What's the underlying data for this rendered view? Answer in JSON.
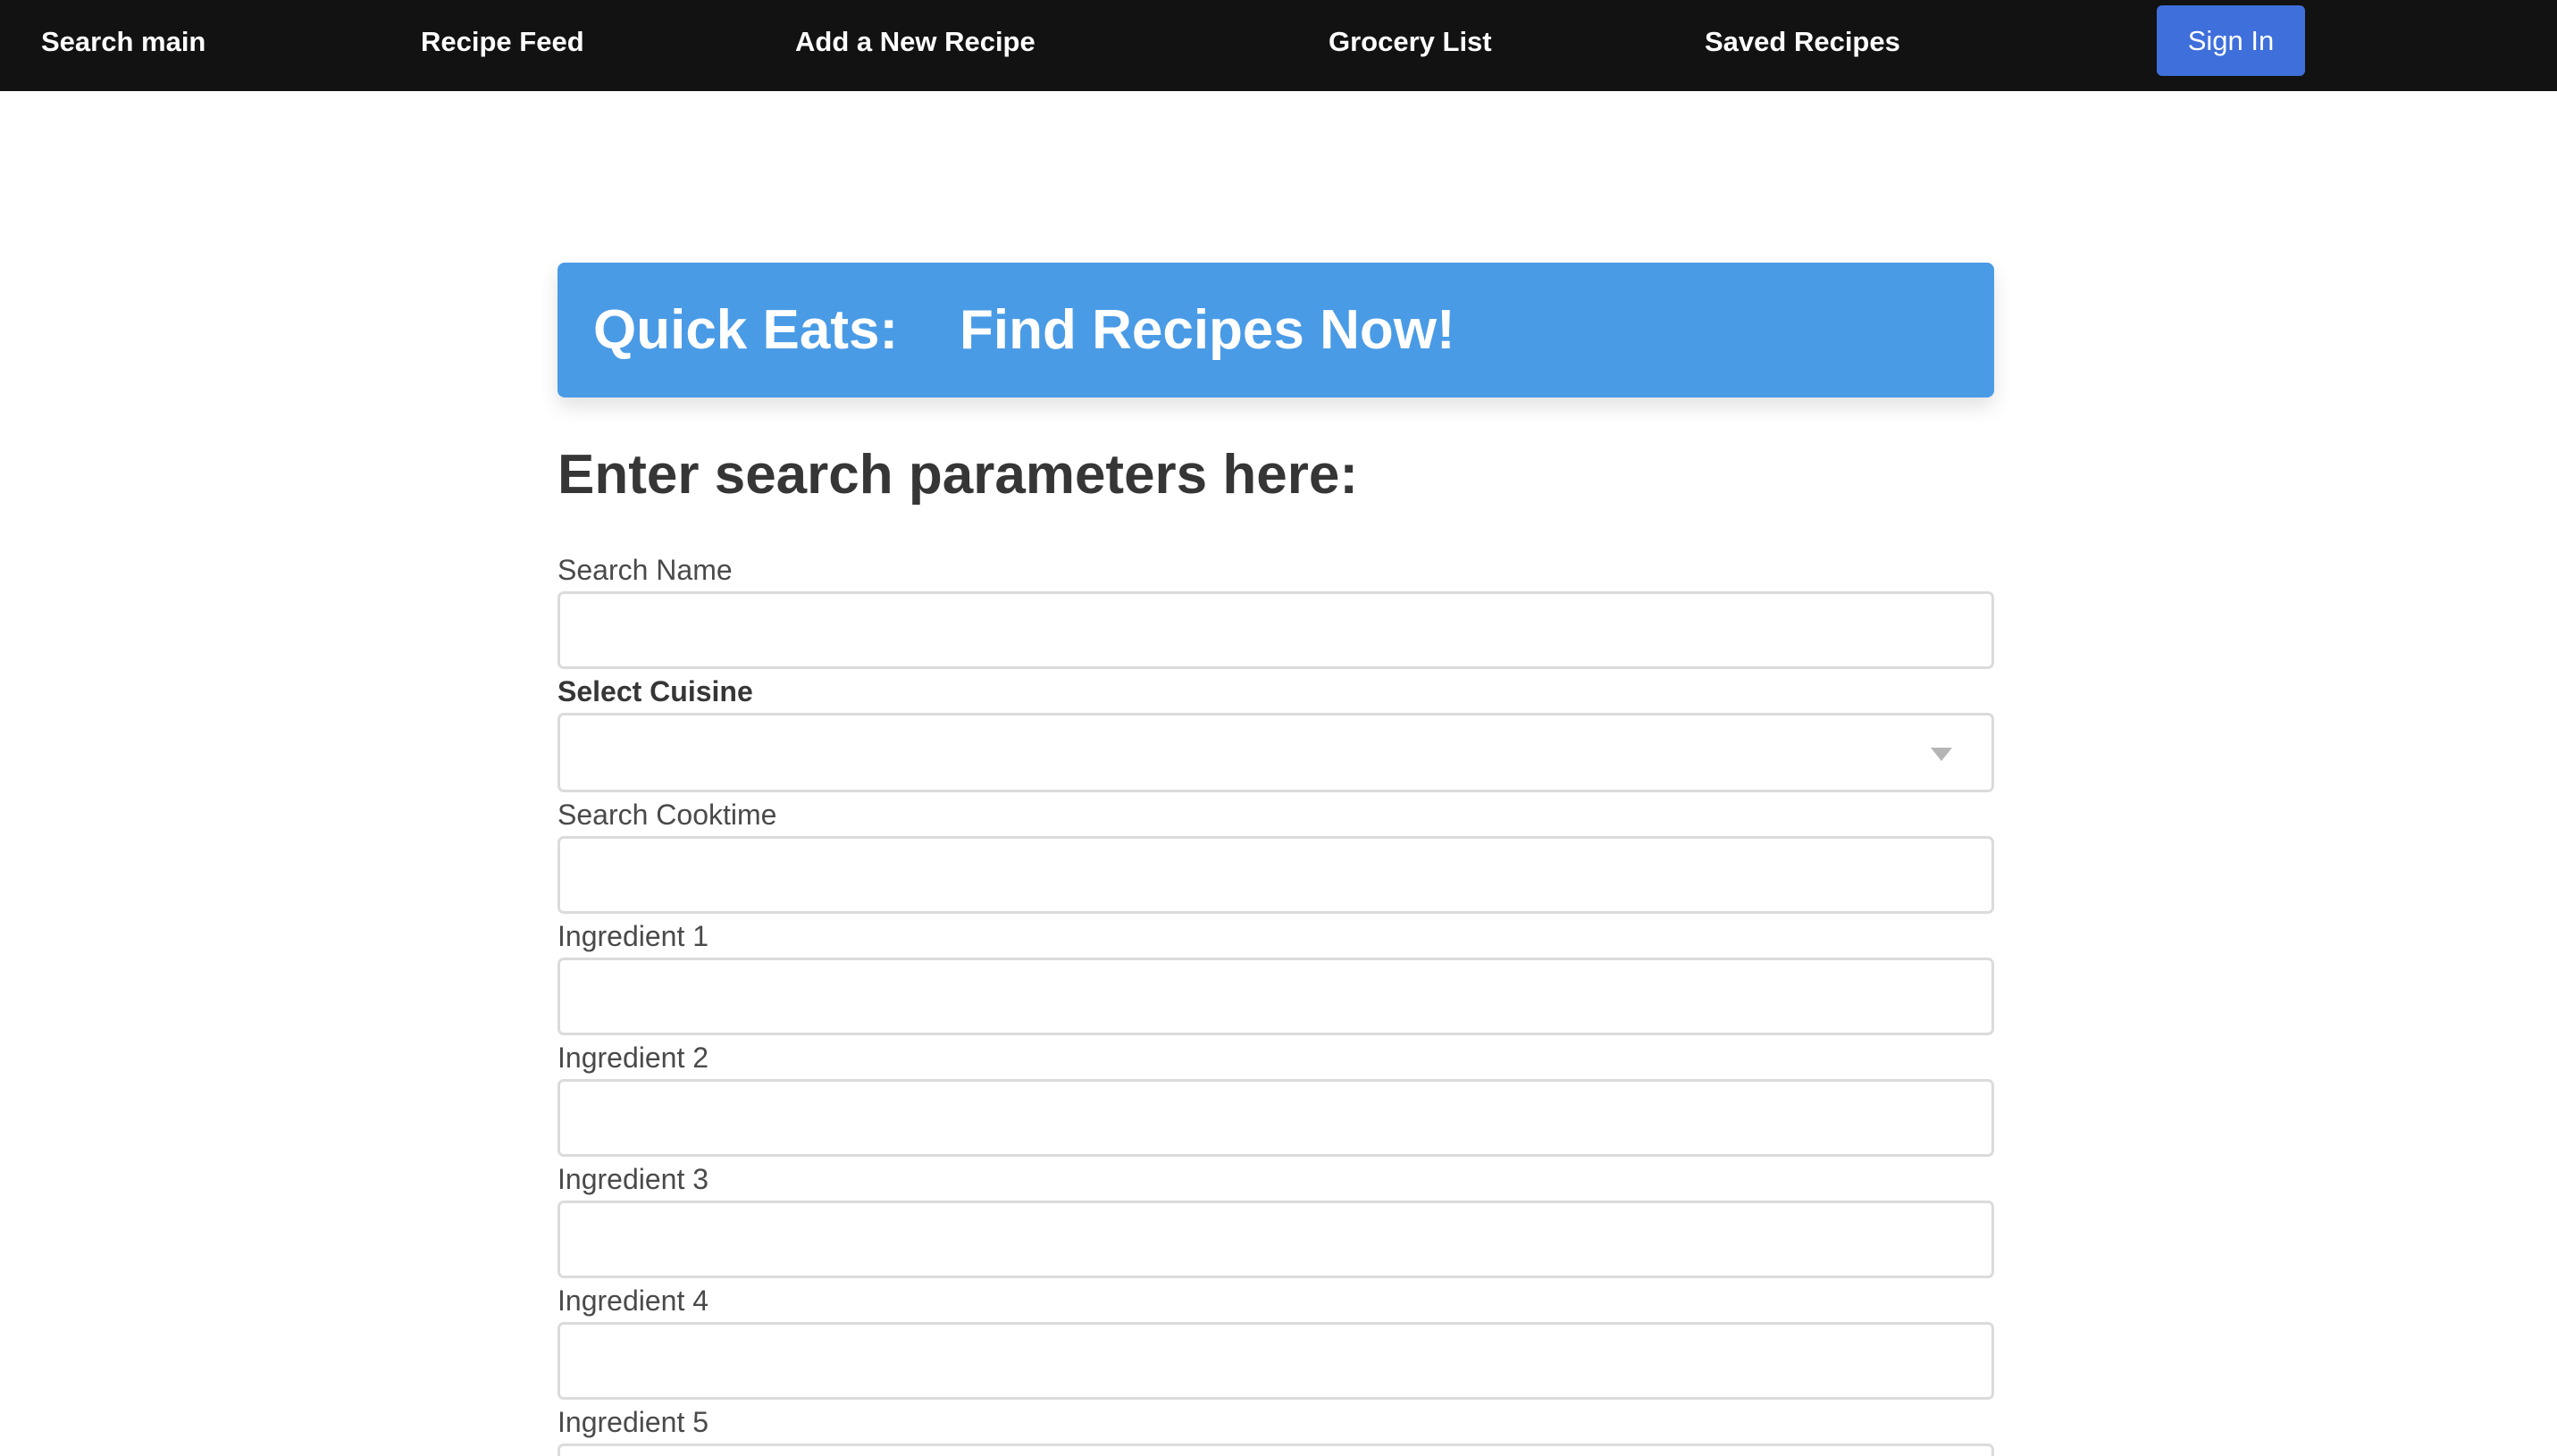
{
  "nav": {
    "items": [
      {
        "label": "Search main"
      },
      {
        "label": "Recipe Feed"
      },
      {
        "label": "Add a New Recipe"
      },
      {
        "label": "Grocery List"
      },
      {
        "label": "Saved Recipes"
      }
    ],
    "signin_label": "Sign In"
  },
  "banner": {
    "title": "Quick Eats:    Find Recipes Now!"
  },
  "form": {
    "heading": "Enter search parameters here:",
    "search_name_label": "Search Name",
    "search_name_value": "",
    "cuisine_label": "Select Cuisine",
    "cuisine_selected": "",
    "cooktime_label": "Search Cooktime",
    "cooktime_value": "",
    "ingredients": [
      {
        "label": "Ingredient 1",
        "value": ""
      },
      {
        "label": "Ingredient 2",
        "value": ""
      },
      {
        "label": "Ingredient 3",
        "value": ""
      },
      {
        "label": "Ingredient 4",
        "value": ""
      },
      {
        "label": "Ingredient 5",
        "value": ""
      }
    ]
  },
  "colors": {
    "navbar_bg": "#121212",
    "signin_bg": "#3e6fdb",
    "banner_bg": "#4a9be6"
  }
}
